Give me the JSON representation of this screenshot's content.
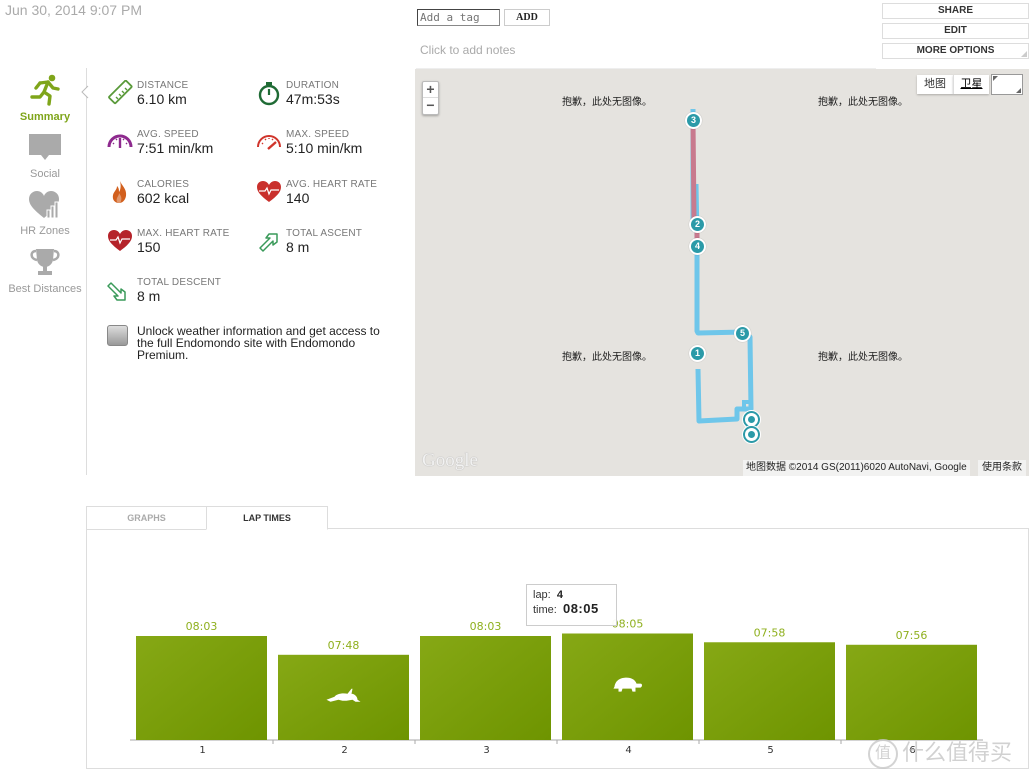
{
  "header": {
    "date": "Jun 30, 2014 9:07 PM",
    "tag_placeholder": "Add a tag",
    "add_label": "ADD",
    "notes_placeholder": "Click to add notes",
    "actions": [
      "SHARE",
      "EDIT",
      "MORE OPTIONS"
    ]
  },
  "sidebar": {
    "items": [
      {
        "label": "Summary",
        "icon": "runner-icon",
        "active": true
      },
      {
        "label": "Social",
        "icon": "speech-bubble-icon",
        "active": false
      },
      {
        "label": "HR Zones",
        "icon": "heart-chart-icon",
        "active": false
      },
      {
        "label": "Best Distances",
        "icon": "trophy-icon",
        "active": false
      }
    ]
  },
  "stats": [
    {
      "key": "DISTANCE",
      "value": "6.10 km",
      "icon": "ruler-icon",
      "color": "#5a9a3a"
    },
    {
      "key": "DURATION",
      "value": "47m:53s",
      "icon": "stopwatch-icon",
      "color": "#1f6b35"
    },
    {
      "key": "AVG. SPEED",
      "value": "7:51 min/km",
      "icon": "speedometer-icon",
      "color": "#8e2a8e"
    },
    {
      "key": "MAX. SPEED",
      "value": "5:10 min/km",
      "icon": "speedometer-max-icon",
      "color": "#d0352c"
    },
    {
      "key": "CALORIES",
      "value": "602 kcal",
      "icon": "flame-icon",
      "color": "#d2601e"
    },
    {
      "key": "AVG. HEART RATE",
      "value": "140",
      "icon": "heart-pulse-icon",
      "color": "#c9302c"
    },
    {
      "key": "MAX. HEART RATE",
      "value": "150",
      "icon": "heart-pulse-max-icon",
      "color": "#b5232a"
    },
    {
      "key": "TOTAL ASCENT",
      "value": "8 m",
      "icon": "arrow-up-right-icon",
      "color": "#3a9a5a"
    },
    {
      "key": "TOTAL DESCENT",
      "value": "8 m",
      "icon": "arrow-down-right-icon",
      "color": "#3a9a5a"
    }
  ],
  "promo": {
    "text": "Unlock weather information and get access to the full Endomondo site with Endomondo Premium."
  },
  "map": {
    "no_image_text": "抱歉，此处无图像。",
    "zoom_in": "+",
    "zoom_out": "−",
    "type_map": "地图",
    "type_satellite": "卫星",
    "google": "Google",
    "attribution": "地图数据 ©2014 GS(2011)6020 AutoNavi, Google",
    "terms": "使用条款",
    "markers": [
      "3",
      "2",
      "4",
      "5",
      "1"
    ],
    "route_color": "#6ec6ea",
    "highlight_color": "#c87a8e",
    "marker_color": "#2b9aa8"
  },
  "tabs": {
    "items": [
      {
        "label": "GRAPHS",
        "active": false
      },
      {
        "label": "LAP TIMES",
        "active": true
      }
    ]
  },
  "tooltip": {
    "lap_label": "lap:",
    "lap_value": "4",
    "time_label": "time:",
    "time_value": "08:05"
  },
  "chart_data": {
    "type": "bar",
    "title": "Lap Times",
    "xlabel": "",
    "ylabel": "",
    "categories": [
      "1",
      "2",
      "3",
      "4",
      "5",
      "6"
    ],
    "values_seconds": [
      483,
      468,
      483,
      485,
      478,
      476
    ],
    "labels": [
      "08:03",
      "07:48",
      "08:03",
      "08:05",
      "07:58",
      "07:56"
    ],
    "markers": {
      "fastest_lap": "2",
      "fastest_icon": "hare-icon",
      "slowest_lap": "4",
      "slowest_icon": "turtle-icon"
    },
    "bar_color": "#7aa012",
    "label_color": "#8fb01e",
    "grid": false
  },
  "watermark": {
    "circle": "值",
    "text": "什么值得买"
  }
}
